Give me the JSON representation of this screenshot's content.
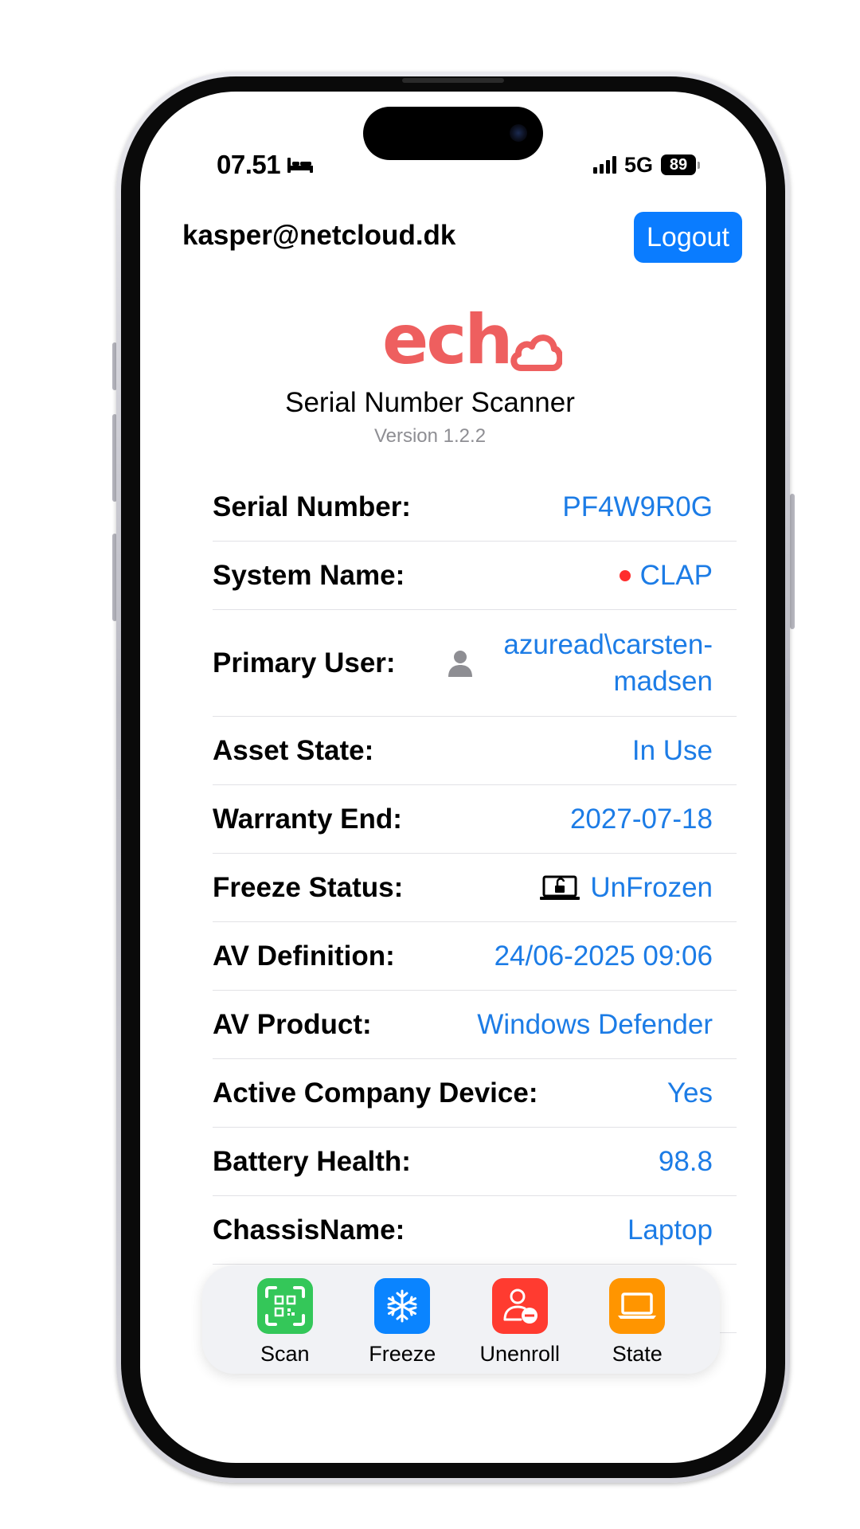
{
  "status_bar": {
    "time": "07.51",
    "network": "5G",
    "battery": "89"
  },
  "header": {
    "user_email": "kasper@netcloud.dk",
    "logout_label": "Logout"
  },
  "app": {
    "logo_text": "ech",
    "title": "Serial Number Scanner",
    "version": "Version 1.2.2"
  },
  "details": [
    {
      "label": "Serial Number:",
      "value": "PF4W9R0G"
    },
    {
      "label": "System Name:",
      "value": "CLAP",
      "indicator": "red-dot"
    },
    {
      "label": "Primary User:",
      "value": "azuread\\carsten-madsen",
      "icon": "person-icon"
    },
    {
      "label": "Asset State:",
      "value": "In Use"
    },
    {
      "label": "Warranty End:",
      "value": "2027-07-18"
    },
    {
      "label": "Freeze Status:",
      "value": "UnFrozen",
      "icon": "laptop-unlock-icon"
    },
    {
      "label": "AV Definition:",
      "value": "24/06-2025 09:06"
    },
    {
      "label": "AV Product:",
      "value": "Windows Defender"
    },
    {
      "label": "Active Company Device:",
      "value": "Yes"
    },
    {
      "label": "Battery Health:",
      "value": "98.8"
    },
    {
      "label": "ChassisName:",
      "value": "Laptop"
    }
  ],
  "toolbar": [
    {
      "label": "Scan",
      "icon": "qr-scan-icon",
      "color": "#34c759"
    },
    {
      "label": "Freeze",
      "icon": "snowflake-icon",
      "color": "#0a84ff"
    },
    {
      "label": "Unenroll",
      "icon": "person-remove-icon",
      "color": "#ff3b30"
    },
    {
      "label": "State",
      "icon": "laptop-icon",
      "color": "#ff9500"
    }
  ],
  "colors": {
    "accent": "#0a7cff",
    "value_text": "#1c7ce6",
    "logo": "#ee5f5f"
  }
}
